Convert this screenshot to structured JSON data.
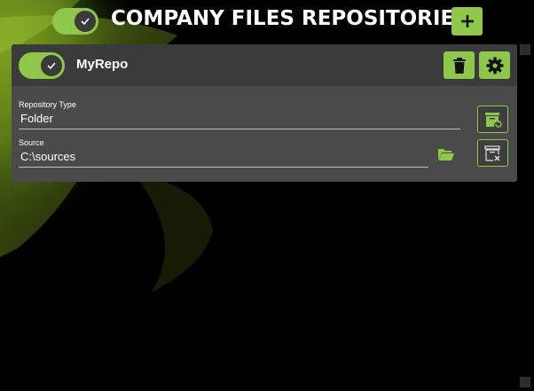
{
  "header": {
    "title": "COMPANY FILES REPOSITORIES",
    "toggle_icon": "checkmark-icon",
    "add_icon": "plus-icon"
  },
  "repo": {
    "name": "MyRepo",
    "enabled": true,
    "delete_icon": "trash-icon",
    "settings_icon": "gear-icon",
    "fields": {
      "type_label": "Repository Type",
      "type_value": "Folder",
      "source_label": "Source",
      "source_value": "C:\\sources"
    },
    "folder_icon": "folder-open-icon",
    "type_action_icon": "archive-refresh-icon",
    "source_action_icon": "archive-remove-icon"
  },
  "colors": {
    "accent": "#8fc74b",
    "card": "#4a4a4a",
    "card_header": "#3b3b3b",
    "background": "#000000"
  }
}
